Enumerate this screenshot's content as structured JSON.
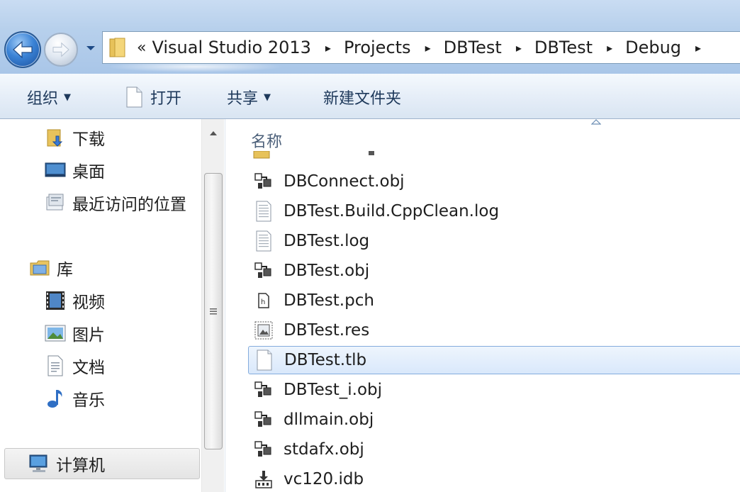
{
  "address": {
    "overflow": "«",
    "breadcrumbs": [
      "Visual Studio 2013",
      "Projects",
      "DBTest",
      "DBTest",
      "Debug"
    ],
    "separator": "▸"
  },
  "commandbar": {
    "organize": "组织",
    "open": "打开",
    "share": "共享",
    "new_folder": "新建文件夹",
    "dropdown_caret": "▼"
  },
  "nav": {
    "items": [
      {
        "label": "下载",
        "icon": "downloads-folder-icon"
      },
      {
        "label": "桌面",
        "icon": "desktop-icon"
      },
      {
        "label": "最近访问的位置",
        "icon": "recent-places-icon"
      },
      {
        "label": "库",
        "icon": "libraries-icon"
      },
      {
        "label": "视频",
        "icon": "videos-icon"
      },
      {
        "label": "图片",
        "icon": "pictures-icon"
      },
      {
        "label": "文档",
        "icon": "documents-icon"
      },
      {
        "label": "音乐",
        "icon": "music-icon"
      },
      {
        "label": "计算机",
        "icon": "computer-icon"
      }
    ]
  },
  "content": {
    "column_name": "名称",
    "files": [
      {
        "name": "DBConnect.obj",
        "icon": "obj-file-icon"
      },
      {
        "name": "DBTest.Build.CppClean.log",
        "icon": "text-file-icon"
      },
      {
        "name": "DBTest.log",
        "icon": "text-file-icon"
      },
      {
        "name": "DBTest.obj",
        "icon": "obj-file-icon"
      },
      {
        "name": "DBTest.pch",
        "icon": "pch-file-icon"
      },
      {
        "name": "DBTest.res",
        "icon": "res-file-icon"
      },
      {
        "name": "DBTest.tlb",
        "icon": "blank-file-icon",
        "selected": true
      },
      {
        "name": "DBTest_i.obj",
        "icon": "obj-file-icon"
      },
      {
        "name": "dllmain.obj",
        "icon": "obj-file-icon"
      },
      {
        "name": "stdafx.obj",
        "icon": "obj-file-icon"
      },
      {
        "name": "vc120.idb",
        "icon": "idb-file-icon"
      }
    ]
  },
  "colors": {
    "selection_border": "#84acdd",
    "titlebar": "#b7d0ec",
    "command_text": "#1e395b"
  }
}
